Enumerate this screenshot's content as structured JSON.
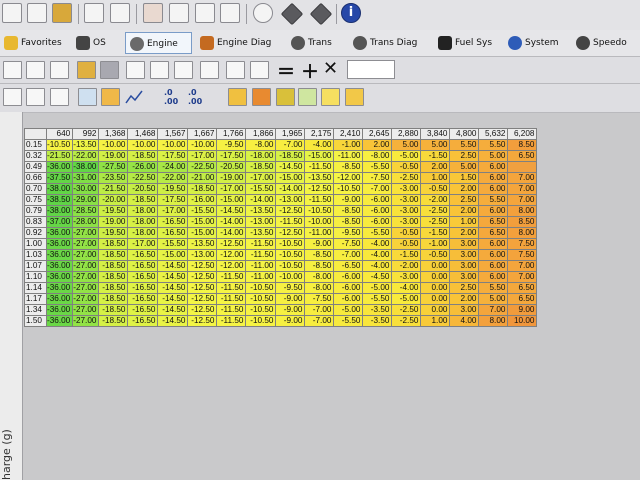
{
  "tabs": [
    {
      "label": "Favorites",
      "icon": "star-icon"
    },
    {
      "label": "OS",
      "icon": "chip-icon"
    },
    {
      "label": "Engine",
      "icon": "engine-icon",
      "active": true
    },
    {
      "label": "Engine Diag",
      "icon": "engine-diag-icon"
    },
    {
      "label": "Trans",
      "icon": "gear-icon"
    },
    {
      "label": "Trans Diag",
      "icon": "trans-diag-icon"
    },
    {
      "label": "Fuel Sys",
      "icon": "fuel-pump-icon"
    },
    {
      "label": "System",
      "icon": "globe-icon"
    },
    {
      "label": "Speedo",
      "icon": "speedo-icon"
    }
  ],
  "decimal_buttons": {
    "inc": ".0\n.00",
    "dec": ".0\n.00"
  },
  "axis_label": "harge (g)",
  "grid": {
    "columns": [
      "640",
      "992",
      "1,368",
      "1,468",
      "1,567",
      "1,667",
      "1,766",
      "1,866",
      "1,965",
      "2,175",
      "2,410",
      "2,645",
      "2,880",
      "3,840",
      "4,800",
      "5,632",
      "6,208"
    ],
    "rows": [
      {
        "label": "0.15",
        "values": [
          "-10.50",
          "-13.50",
          "-10.00",
          "-10.00",
          "-10.00",
          "-10.00",
          "-9.50",
          "-8.00",
          "-7.00",
          "-4.00",
          "-1.00",
          "2.00",
          "5.00",
          "5.00",
          "5.50",
          "5.50",
          "8.50"
        ]
      },
      {
        "label": "0.32",
        "values": [
          "-21.50",
          "-22.00",
          "-19.00",
          "-18.50",
          "-17.50",
          "-17.00",
          "-17.50",
          "-18.00",
          "-18.50",
          "-15.00",
          "-11.00",
          "-8.00",
          "-5.00",
          "-1.50",
          "2.50",
          "5.00",
          "6.50"
        ]
      },
      {
        "label": "0.49",
        "values": [
          "-36.00",
          "-38.00",
          "-27.50",
          "-26.00",
          "-24.00",
          "-22.50",
          "-20.50",
          "-18.50",
          "-14.50",
          "-11.50",
          "-8.50",
          "-5.50",
          "-0.50",
          "2.00",
          "5.00",
          "6.00"
        ]
      },
      {
        "label": "0.66",
        "values": [
          "-37.50",
          "-31.00",
          "-23.50",
          "-22.50",
          "-22.00",
          "-21.00",
          "-19.00",
          "-17.00",
          "-15.00",
          "-13.50",
          "-12.00",
          "-7.50",
          "-2.50",
          "1.00",
          "1.50",
          "6.00",
          "7.00"
        ]
      },
      {
        "label": "0.70",
        "values": [
          "-38.00",
          "-30.00",
          "-21.50",
          "-20.50",
          "-19.50",
          "-18.50",
          "-17.00",
          "-15.50",
          "-14.00",
          "-12.50",
          "-10.50",
          "-7.00",
          "-3.00",
          "-0.50",
          "2.00",
          "6.00",
          "7.00"
        ]
      },
      {
        "label": "0.75",
        "values": [
          "-38.50",
          "-29.00",
          "-20.00",
          "-18.50",
          "-17.50",
          "-16.00",
          "-15.00",
          "-14.00",
          "-13.00",
          "-11.50",
          "-9.00",
          "-6.00",
          "-3.00",
          "-2.00",
          "2.50",
          "5.50",
          "7.00"
        ]
      },
      {
        "label": "0.79",
        "values": [
          "-38.00",
          "-28.50",
          "-19.50",
          "-18.00",
          "-17.00",
          "-15.50",
          "-14.50",
          "-13.50",
          "-12.50",
          "-10.50",
          "-8.50",
          "-6.00",
          "-3.00",
          "-2.50",
          "2.00",
          "6.00",
          "8.00"
        ]
      },
      {
        "label": "0.83",
        "values": [
          "-37.00",
          "-28.00",
          "-19.00",
          "-18.00",
          "-16.50",
          "-15.00",
          "-14.00",
          "-13.00",
          "-11.50",
          "-10.00",
          "-8.50",
          "-6.00",
          "-3.00",
          "-2.50",
          "1.00",
          "6.50",
          "8.50"
        ]
      },
      {
        "label": "0.92",
        "values": [
          "-36.00",
          "-27.00",
          "-19.50",
          "-18.00",
          "-16.50",
          "-15.00",
          "-14.00",
          "-13.50",
          "-12.50",
          "-11.00",
          "-9.50",
          "-5.50",
          "-0.50",
          "-1.50",
          "2.00",
          "6.50",
          "8.00"
        ]
      },
      {
        "label": "1.00",
        "values": [
          "-36.00",
          "-27.00",
          "-18.50",
          "-17.00",
          "-15.50",
          "-13.50",
          "-12.50",
          "-11.50",
          "-10.50",
          "-9.00",
          "-7.50",
          "-4.00",
          "-0.50",
          "-1.00",
          "3.00",
          "6.00",
          "7.50"
        ]
      },
      {
        "label": "1.03",
        "values": [
          "-36.00",
          "-27.00",
          "-18.50",
          "-16.50",
          "-15.00",
          "-13.00",
          "-12.00",
          "-11.50",
          "-10.50",
          "-8.50",
          "-7.00",
          "-4.00",
          "-1.50",
          "-0.50",
          "3.00",
          "6.00",
          "7.50"
        ]
      },
      {
        "label": "1.07",
        "values": [
          "-36.00",
          "-27.00",
          "-18.50",
          "-16.50",
          "-14.50",
          "-12.50",
          "-12.00",
          "-11.00",
          "-10.50",
          "-8.50",
          "-6.50",
          "-4.00",
          "-2.00",
          "0.00",
          "3.00",
          "6.00",
          "7.00"
        ]
      },
      {
        "label": "1.10",
        "values": [
          "-36.00",
          "-27.00",
          "-18.50",
          "-16.50",
          "-14.50",
          "-12.50",
          "-11.50",
          "-11.00",
          "-10.00",
          "-8.00",
          "-6.00",
          "-4.50",
          "-3.00",
          "0.00",
          "3.00",
          "6.00",
          "7.00"
        ]
      },
      {
        "label": "1.14",
        "values": [
          "-36.00",
          "-27.00",
          "-18.50",
          "-16.50",
          "-14.50",
          "-12.50",
          "-11.50",
          "-10.50",
          "-9.50",
          "-8.00",
          "-6.00",
          "-5.00",
          "-4.00",
          "0.00",
          "2.50",
          "5.50",
          "6.50"
        ]
      },
      {
        "label": "1.17",
        "values": [
          "-36.00",
          "-27.00",
          "-18.50",
          "-16.50",
          "-14.50",
          "-12.50",
          "-11.50",
          "-10.50",
          "-9.00",
          "-7.50",
          "-6.00",
          "-5.50",
          "-5.00",
          "0.00",
          "2.00",
          "5.00",
          "6.50"
        ]
      },
      {
        "label": "1.34",
        "values": [
          "-36.00",
          "-27.00",
          "-18.50",
          "-16.50",
          "-14.50",
          "-12.50",
          "-11.50",
          "-10.50",
          "-9.00",
          "-7.00",
          "-5.00",
          "-3.50",
          "-2.50",
          "0.00",
          "3.00",
          "7.00",
          "9.00"
        ]
      },
      {
        "label": "1.50",
        "values": [
          "-36.00",
          "-27.00",
          "-18.50",
          "-16.50",
          "-14.50",
          "-12.50",
          "-11.50",
          "-10.50",
          "-9.00",
          "-7.00",
          "-5.50",
          "-3.50",
          "-2.50",
          "1.00",
          "4.00",
          "8.00",
          "10.00"
        ]
      }
    ]
  }
}
